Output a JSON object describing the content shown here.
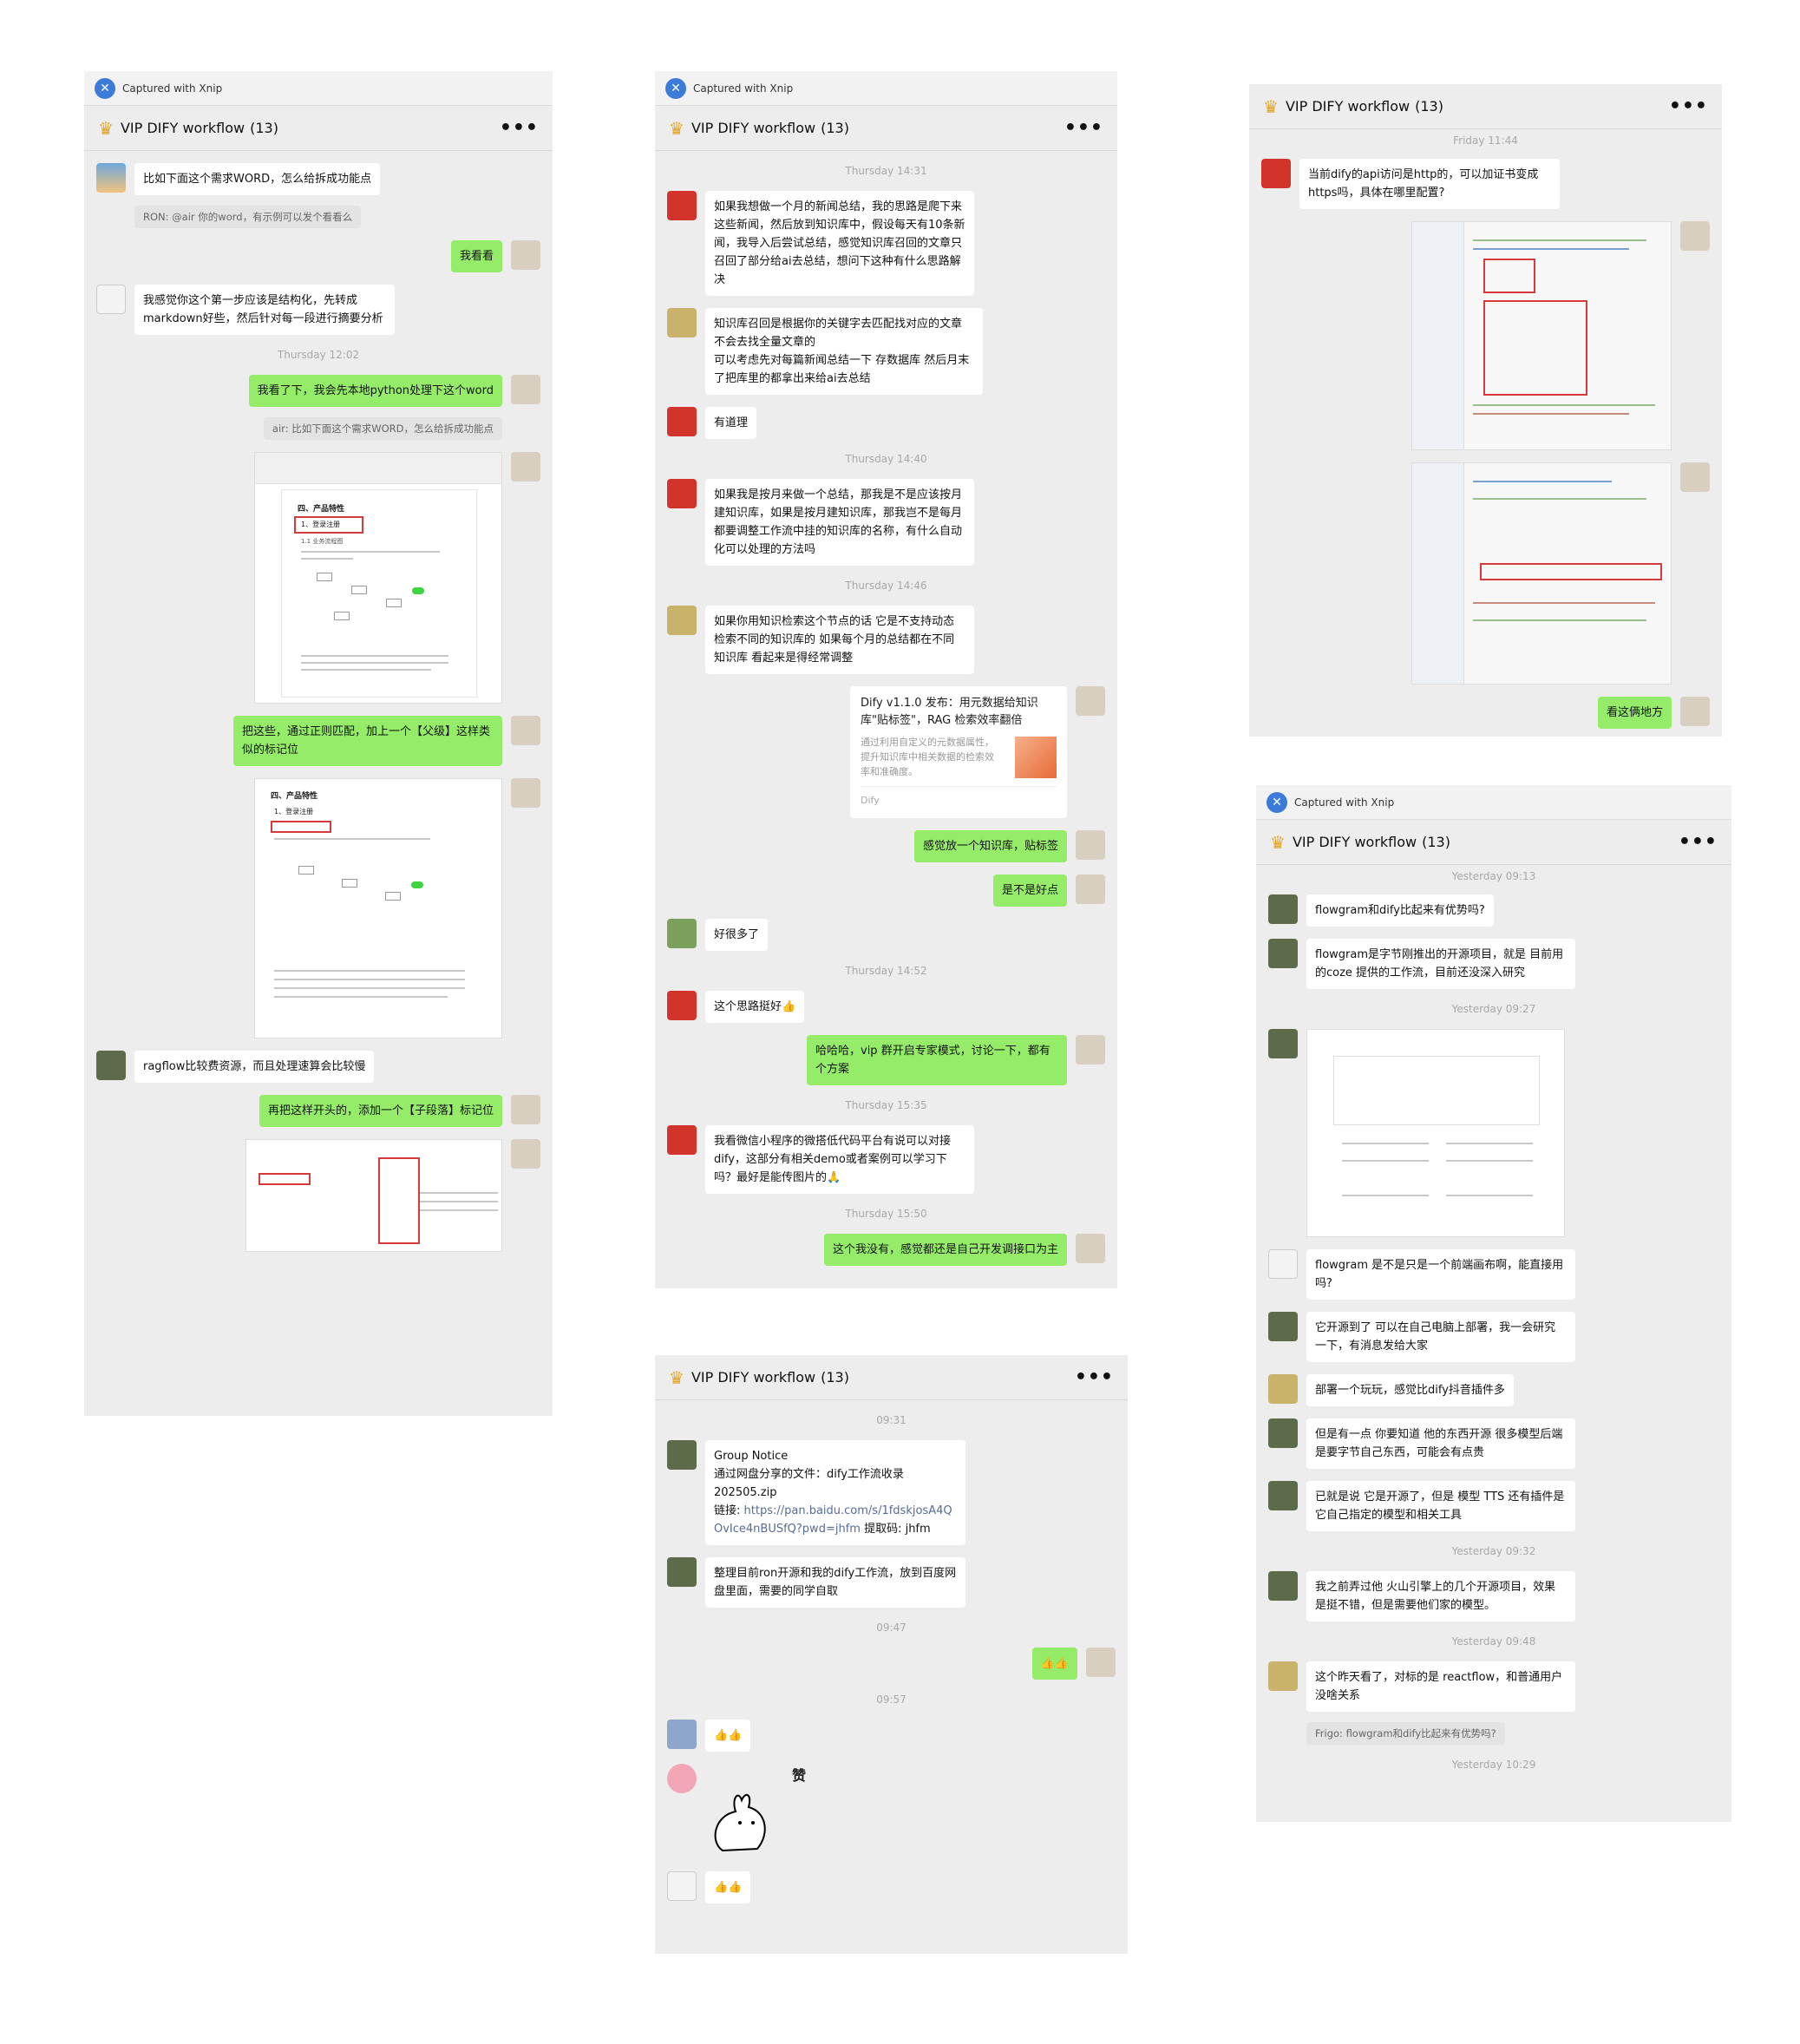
{
  "xnip": {
    "caption": "Captured with Xnip"
  },
  "chat": {
    "title": "VIP DIFY workflow",
    "count": "(13)",
    "more": "•••"
  },
  "panel1": {
    "messages": [
      {
        "text": "比如下面这个需求WORD，怎么给拆成功能点"
      },
      {
        "quote": "RON: @air 你的word，有示例可以发个看看么"
      },
      {
        "text": "我看看"
      },
      {
        "text": "我感觉你这个第一步应该是结构化，先转成markdown好些，然后针对每一段进行摘要分析"
      },
      {
        "ts": "Thursday 12:02"
      },
      {
        "text": "我看了下，我会先本地python处理下这个word"
      },
      {
        "quote": "air: 比如下面这个需求WORD，怎么给拆成功能点"
      },
      {
        "doc_title": "四、产品特性",
        "doc_sub": "1、登录注册",
        "doc_sub2": "1.1 业务流程图"
      },
      {
        "text": "把这些，通过正则匹配，加上一个【父级】这样类似的标记位"
      },
      {
        "doc_title": "四、产品特性",
        "doc_sub": "1、登录注册"
      },
      {
        "text": "ragflow比较费资源，而且处理速算会比较慢"
      },
      {
        "text": "再把这样开头的，添加一个【子段落】标记位"
      }
    ]
  },
  "panel2": {
    "messages": [
      {
        "ts": "Thursday 14:31"
      },
      {
        "text": "如果我想做一个月的新闻总结，我的思路是爬下来这些新闻，然后放到知识库中，假设每天有10条新闻，我导入后尝试总结，感觉知识库召回的文章只召回了部分给ai去总结，想问下这种有什么思路解决"
      },
      {
        "text": "知识库召回是根据你的关键字去匹配找对应的文章  不会去找全量文章的\n可以考虑先对每篇新闻总结一下 存数据库   然后月末了把库里的都拿出来给ai去总结"
      },
      {
        "text": "有道理"
      },
      {
        "ts": "Thursday 14:40"
      },
      {
        "text": "如果我是按月来做一个总结，那我是不是应该按月建知识库，如果是按月建知识库，那我岂不是每月都要调整工作流中挂的知识库的名称，有什么自动化可以处理的方法吗"
      },
      {
        "ts": "Thursday 14:46"
      },
      {
        "text": "如果你用知识检索这个节点的话   它是不支持动态检索不同的知识库的   如果每个月的总结都在不同知识库  看起来是得经常调整"
      },
      {
        "card_title": "Dify v1.1.0 发布：用元数据给知识库\"贴标签\"，RAG 检索效率翻倍",
        "card_desc": "通过利用自定义的元数据属性，提升知识库中相关数据的检索效率和准确度。",
        "card_src": "Dify"
      },
      {
        "text": "感觉放一个知识库，贴标签"
      },
      {
        "text": "是不是好点"
      },
      {
        "text": "好很多了"
      },
      {
        "ts": "Thursday 14:52"
      },
      {
        "text": "这个思路挺好👍"
      },
      {
        "text": "哈哈哈，vip 群开启专家模式，讨论一下，都有个方案"
      },
      {
        "ts": "Thursday 15:35"
      },
      {
        "text": "我看微信小程序的微搭低代码平台有说可以对接dify，这部分有相关demo或者案例可以学习下吗？最好是能传图片的🙏"
      },
      {
        "ts": "Thursday 15:50"
      },
      {
        "text": "这个我没有，感觉都还是自己开发调接口为主"
      }
    ]
  },
  "panel3": {
    "messages": [
      {
        "ts": "09:31"
      },
      {
        "notice_title": "Group Notice",
        "notice_body": "通过网盘分享的文件：dify工作流收录202505.zip",
        "notice_link_label": "链接: ",
        "notice_link": "https://pan.baidu.com/s/1fdskjosA4QOvIce4nBUSfQ?pwd=jhfm",
        "notice_tail": " 提取码: jhfm"
      },
      {
        "text": "整理目前ron开源和我的dify工作流，放到百度网盘里面，需要的同学自取"
      },
      {
        "ts": "09:47"
      },
      {
        "text": "👍👍"
      },
      {
        "ts": "09:57"
      },
      {
        "text": "👍👍"
      },
      {
        "sticker_label": "赞"
      },
      {
        "text": "👍👍"
      }
    ]
  },
  "panel4": {
    "messages": [
      {
        "ts": "Friday 11:44"
      },
      {
        "text": "当前dify的api访问是http的，可以加证书变成https吗，具体在哪里配置?"
      },
      {
        "text": "看这俩地方"
      }
    ]
  },
  "panel5": {
    "messages": [
      {
        "ts": "Yesterday 09:13"
      },
      {
        "text": "flowgram和dify比起来有优势吗?"
      },
      {
        "text": "flowgram是字节刚推出的开源项目，就是 目前用的coze 提供的工作流，目前还没深入研究"
      },
      {
        "ts": "Yesterday 09:27"
      },
      {
        "text": "flowgram 是不是只是一个前端画布啊，能直接用吗?"
      },
      {
        "text": "它开源到了 可以在自己电脑上部署，我一会研究一下，有消息发给大家"
      },
      {
        "text": "部署一个玩玩，感觉比dify抖音插件多"
      },
      {
        "text": "但是有一点 你要知道 他的东西开源 很多模型后端是要字节自己东西，可能会有点贵"
      },
      {
        "text": "已就是说 它是开源了，但是 模型  TTS 还有插件是 它自己指定的模型和相关工具"
      },
      {
        "ts": "Yesterday 09:32"
      },
      {
        "text": "我之前弄过他 火山引擎上的几个开源项目，效果是挺不错，但是需要他们家的模型。"
      },
      {
        "ts": "Yesterday 09:48"
      },
      {
        "text": "这个昨天看了，对标的是 reactflow，和普通用户没啥关系"
      },
      {
        "quote": "Frigo: flowgram和dify比起来有优势吗?"
      },
      {
        "ts": "Yesterday 10:29"
      }
    ]
  }
}
